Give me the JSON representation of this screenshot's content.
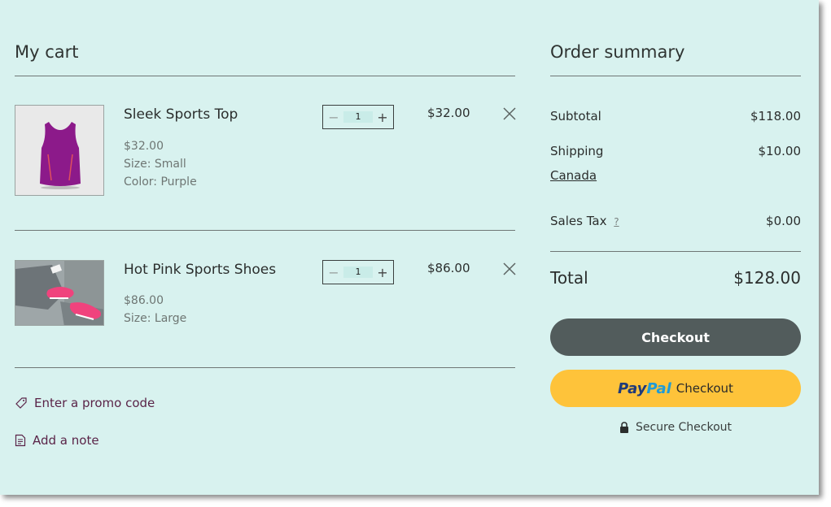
{
  "cart": {
    "title": "My cart",
    "items": [
      {
        "name": "Sleek Sports Top",
        "unit_price": "$32.00",
        "options": [
          "Size: Small",
          "Color: Purple"
        ],
        "quantity": "1",
        "total": "$32.00"
      },
      {
        "name": "Hot Pink Sports Shoes",
        "unit_price": "$86.00",
        "options": [
          "Size: Large"
        ],
        "quantity": "1",
        "total": "$86.00"
      }
    ],
    "promo_label": "Enter a promo code",
    "note_label": "Add a note"
  },
  "summary": {
    "title": "Order summary",
    "subtotal_label": "Subtotal",
    "subtotal_value": "$118.00",
    "shipping_label": "Shipping",
    "shipping_value": "$10.00",
    "shipping_region": "Canada",
    "tax_label": "Sales Tax",
    "tax_help": "?",
    "tax_value": "$0.00",
    "total_label": "Total",
    "total_value": "$128.00",
    "checkout_label": "Checkout",
    "paypal_pay": "Pay",
    "paypal_pal": "Pal",
    "paypal_label": "Checkout",
    "secure_label": "Secure Checkout"
  },
  "colors": {
    "background": "#d8f2ef",
    "checkout_button": "#525c5c",
    "paypal_button": "#fec33a",
    "link": "#5a2448"
  },
  "icons": {
    "remove": "close-icon",
    "promo": "tag-icon",
    "note": "note-icon",
    "secure": "lock-icon"
  }
}
